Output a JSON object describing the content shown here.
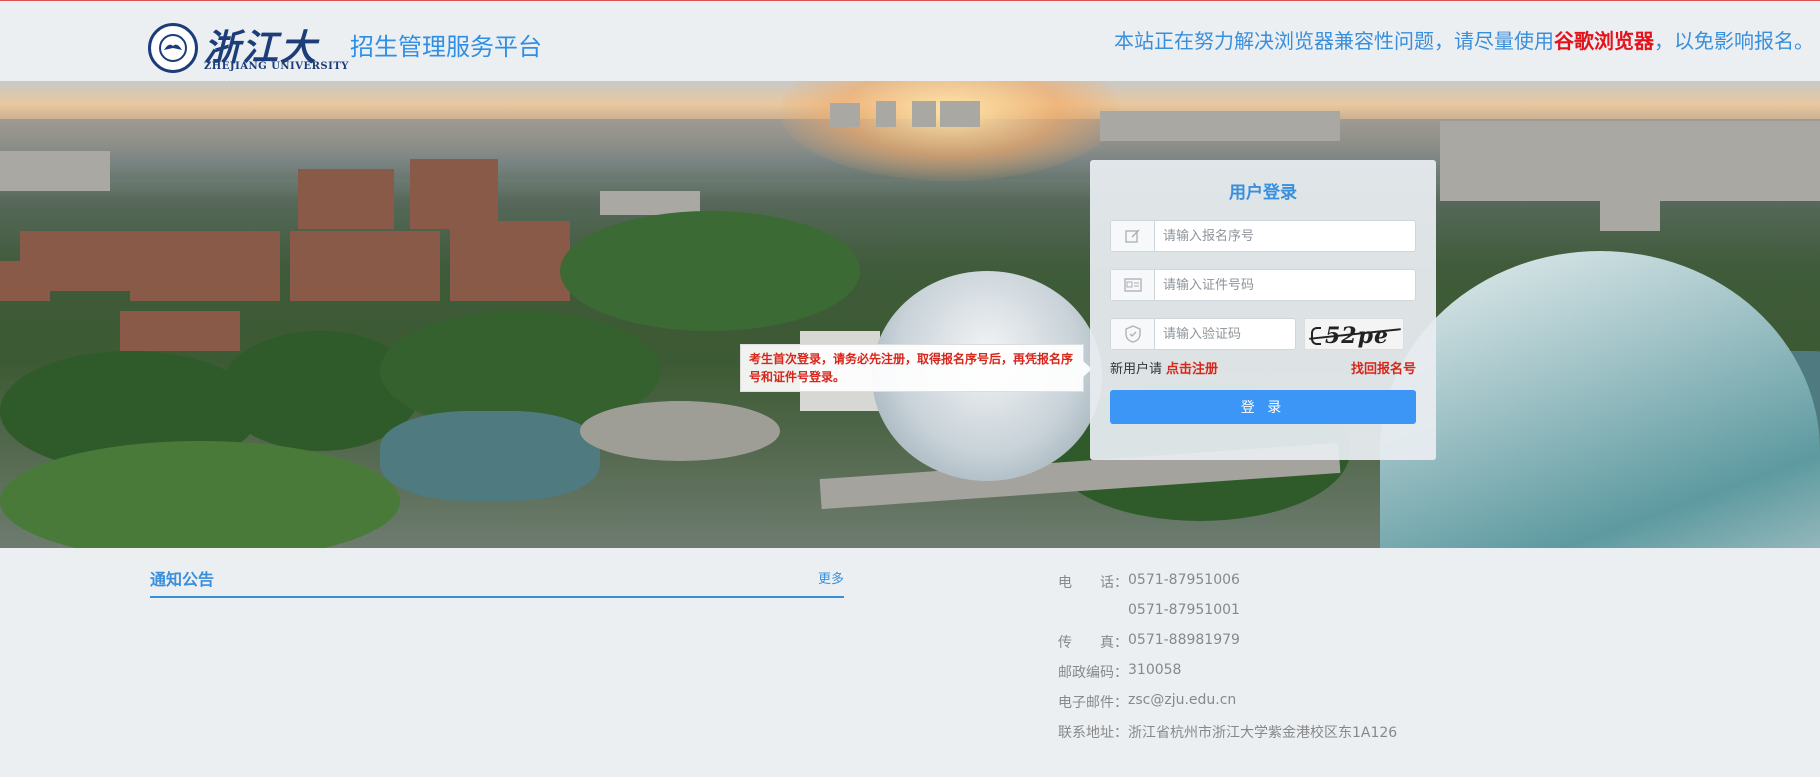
{
  "header": {
    "logo_cn": "浙江大学",
    "logo_en": "ZHEJIANG UNIVERSITY",
    "platform_title": "招生管理服务平台",
    "notice_pre": "本站正在努力解决浏览器兼容性问题，请尽量使用",
    "notice_highlight": "谷歌浏览器",
    "notice_post": "，以免影响报名。"
  },
  "tooltip": {
    "text": "考生首次登录，请务必先注册，取得报名序号后，再凭报名序号和证件号登录。"
  },
  "login": {
    "title": "用户登录",
    "regno_placeholder": "请输入报名序号",
    "idno_placeholder": "请输入证件号码",
    "captcha_placeholder": "请输入验证码",
    "captcha_text": "52pe",
    "new_user_text": "新用户请",
    "register_link": "点击注册",
    "retrieve_link": "找回报名号",
    "submit_label": "登 录"
  },
  "announcements": {
    "title": "通知公告",
    "more_label": "更多"
  },
  "contact": [
    {
      "key": "电　　话：",
      "value": "0571-87951006"
    },
    {
      "key": "",
      "value": "0571-87951001"
    },
    {
      "key": "传　　真：",
      "value": "0571-88981979"
    },
    {
      "key": "邮政编码：",
      "value": "310058"
    },
    {
      "key": "电子邮件：",
      "value": "zsc@zju.edu.cn"
    },
    {
      "key": "联系地址：",
      "value": "浙江省杭州市浙江大学紫金港校区东1A126"
    }
  ],
  "colors": {
    "accent": "#3a8fdc",
    "alert": "#e4131b",
    "button": "#3b96f5",
    "brand_navy": "#1c3d7a"
  },
  "icons": {
    "regno": "edit-icon",
    "idno": "id-card-icon",
    "captcha": "shield-icon"
  }
}
